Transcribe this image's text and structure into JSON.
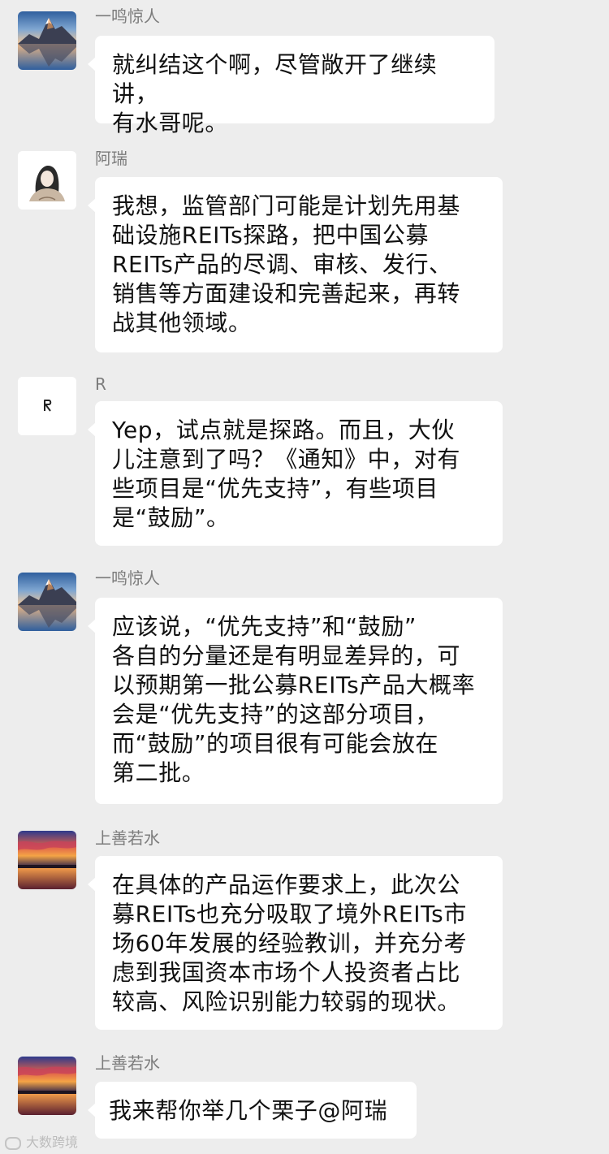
{
  "messages": [
    {
      "sender": "一鸣惊人",
      "avatar": "mountain-lake-avatar-icon",
      "text": "就纠结这个啊，尽管敞开了继续讲，\n有水哥呢。"
    },
    {
      "sender": "阿瑞",
      "avatar": "girl-sketch-avatar-icon",
      "text": "我想，监管部门可能是计划先用基\n础设施REITs探路，把中国公募\nREITs产品的尽调、审核、发行、\n销售等方面建设和完善起来，再转\n战其他领域。"
    },
    {
      "sender": "R",
      "avatar": "letter-r-avatar-icon",
      "text": "Yep，试点就是探路。而且，大伙\n儿注意到了吗？《通知》中，对有\n些项目是“优先支持”，有些项目\n是“鼓励”。"
    },
    {
      "sender": "一鸣惊人",
      "avatar": "mountain-lake-avatar-icon",
      "text": "应该说，“优先支持”和“鼓励”\n各自的分量还是有明显差异的，可\n以预期第一批公募REITs产品大概率\n会是“优先支持”的这部分项目，\n而“鼓励”的项目很有可能会放在\n第二批。"
    },
    {
      "sender": "上善若水",
      "avatar": "sunset-lake-avatar-icon",
      "text": "在具体的产品运作要求上，此次公\n募REITs也充分吸取了境外REITs市\n场60年发展的经验教训，并充分考\n虑到我国资本市场个人投资者占比\n较高、风险识别能力较弱的现状。"
    },
    {
      "sender": "上善若水",
      "avatar": "sunset-lake-avatar-icon",
      "text": "我来帮你举几个栗子@阿瑞"
    }
  ],
  "watermark": "大数跨境"
}
